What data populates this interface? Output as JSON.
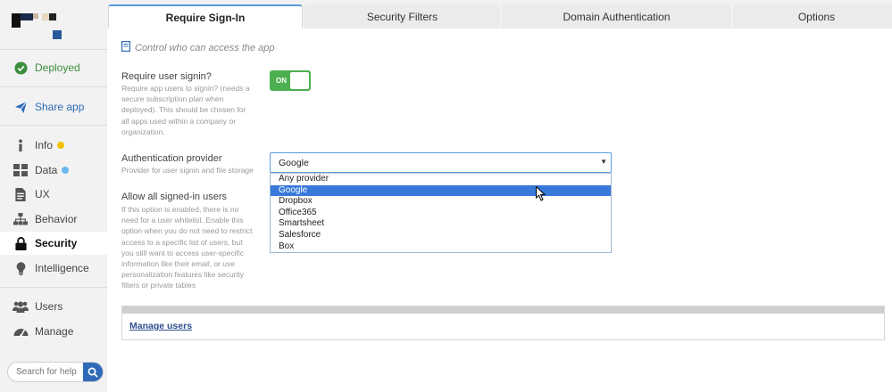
{
  "sidebar": {
    "deployed": "Deployed",
    "share": "Share app",
    "items": [
      {
        "label": "Info",
        "dot": "#f2c200"
      },
      {
        "label": "Data",
        "dot": "#6bb8f0"
      },
      {
        "label": "UX"
      },
      {
        "label": "Behavior"
      },
      {
        "label": "Security"
      },
      {
        "label": "Intelligence"
      }
    ],
    "bottom": [
      {
        "label": "Users"
      },
      {
        "label": "Manage"
      }
    ],
    "search_placeholder": "Search for help"
  },
  "tabs": [
    "Require Sign-In",
    "Security Filters",
    "Domain Authentication",
    "Options"
  ],
  "content": {
    "hint": "Control who can access the app",
    "signin": {
      "title": "Require user signin?",
      "desc": "Require app users to signin? (needs a secure subscription plan when deployed). This should be chosen for all apps used within a company or organization.",
      "toggle": "ON"
    },
    "auth": {
      "title": "Authentication provider",
      "desc": "Provider for user signin and file storage",
      "selected": "Google",
      "options": [
        "Any provider",
        "Google",
        "Dropbox",
        "Office365",
        "Smartsheet",
        "Salesforce",
        "Box"
      ]
    },
    "allow": {
      "title": "Allow all signed-in users",
      "desc": "If this option is enabled, there is no need for a user whitelist. Enable this option when you do not need to restrict access to a specific list of users, but you still want to access user-specific information like their email, or use personalization features like security filters or private tables"
    },
    "manage_users": "Manage users"
  },
  "colors": {
    "accent": "#2f6ab8",
    "toggle_on": "#4caf50",
    "selected_option": "#3879d9",
    "deployed": "#3b8e3b"
  }
}
